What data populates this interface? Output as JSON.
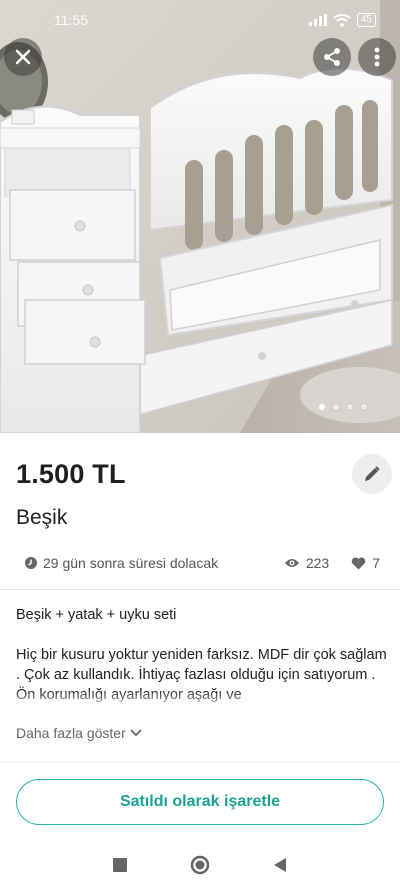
{
  "status_bar": {
    "time": "11:55",
    "network": "4G",
    "battery": "45"
  },
  "listing": {
    "price": "1.500 TL",
    "title": "Beşik",
    "expiry_text": "29 gün sonra süresi dolacak",
    "views": "223",
    "likes": "7",
    "description_line1": "Beşik + yatak + uyku seti",
    "description_line2": "Hiç bir kusuru yoktur yeniden farksız. MDF dir çok sağlam . Çok az kullandık.  İhtiyaç fazlası olduğu için satıyorum . Ön korumalığı ayarlanıyor aşağı ve",
    "show_more": "Daha fazla göster"
  },
  "actions": {
    "mark_sold": "Satıldı olarak işaretle"
  },
  "carousel": {
    "count": 4,
    "active_index": 0
  },
  "icons": {
    "close": "close-icon",
    "share": "share-icon",
    "more": "more-vert-icon",
    "edit": "pencil-icon",
    "clock": "clock-icon",
    "eye": "eye-icon",
    "heart": "heart-icon",
    "chevron": "chevron-down-icon"
  },
  "colors": {
    "accent": "#1aa394"
  }
}
